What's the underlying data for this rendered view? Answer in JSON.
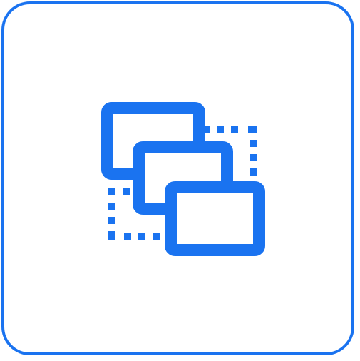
{
  "icon": {
    "name": "cascade-windows-icon",
    "accent_color": "#1A73F0",
    "background_color": "#FFFFFF"
  }
}
